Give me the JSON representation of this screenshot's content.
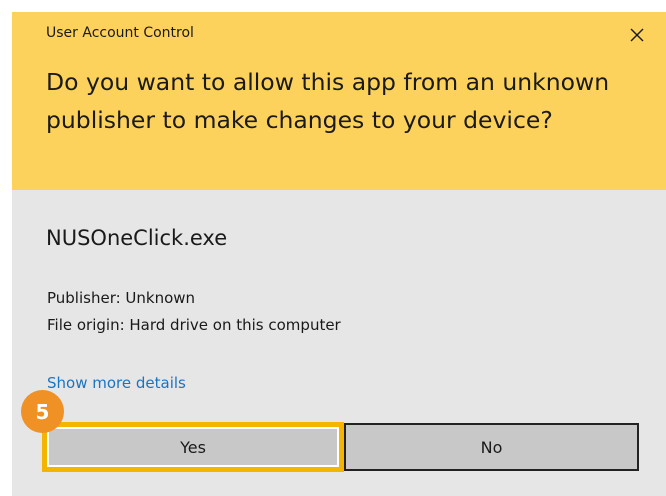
{
  "dialog": {
    "window_title": "User Account Control",
    "question": "Do you want to allow this app from an unknown publisher to make changes to your device?",
    "app_name": "NUSOneClick.exe",
    "publisher": "Publisher: Unknown",
    "file_origin": "File origin: Hard drive on this computer",
    "details_link": "Show more details",
    "yes_label": "Yes",
    "no_label": "No"
  },
  "annotation": {
    "step_number": "5"
  },
  "colors": {
    "header_background": "#fdd25c",
    "body_background": "#e6e6e6",
    "button_background": "#c8c8c8",
    "link": "#1a74c4",
    "highlight_border": "#f5b400",
    "step_badge": "#ef9124"
  },
  "icons": {
    "close": "close-icon"
  }
}
